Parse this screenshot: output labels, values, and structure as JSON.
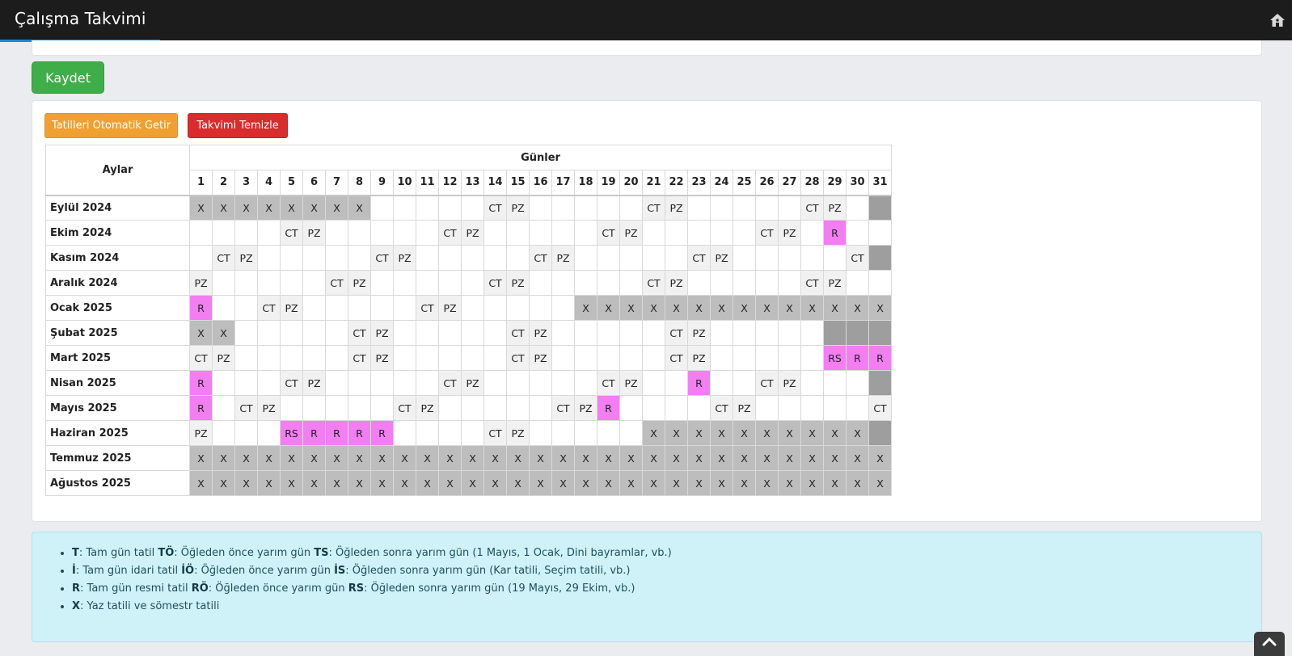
{
  "header": {
    "title": "Çalışma Takvimi",
    "home_icon": "home-icon"
  },
  "actions": {
    "save_label": "Kaydet",
    "auto_holidays_label": "Tatilleri Otomatik Getir",
    "clear_label": "Takvimi Temizle"
  },
  "table": {
    "months_header": "Aylar",
    "days_header": "Günler",
    "days": [
      "1",
      "2",
      "3",
      "4",
      "5",
      "6",
      "7",
      "8",
      "9",
      "10",
      "11",
      "12",
      "13",
      "14",
      "15",
      "16",
      "17",
      "18",
      "19",
      "20",
      "21",
      "22",
      "23",
      "24",
      "25",
      "26",
      "27",
      "28",
      "29",
      "30",
      "31"
    ],
    "rows": [
      {
        "month": "Eylül 2024",
        "cells": [
          "X",
          "X",
          "X",
          "X",
          "X",
          "X",
          "X",
          "X",
          "",
          "",
          "",
          "",
          "",
          "CT",
          "PZ",
          "",
          "",
          "",
          "",
          "",
          "CT",
          "PZ",
          "",
          "",
          "",
          "",
          "",
          "CT",
          "PZ",
          "",
          "D"
        ]
      },
      {
        "month": "Ekim 2024",
        "cells": [
          "",
          "",
          "",
          "",
          "CT",
          "PZ",
          "",
          "",
          "",
          "",
          "",
          "CT",
          "PZ",
          "",
          "",
          "",
          "",
          "",
          "CT",
          "PZ",
          "",
          "",
          "",
          "",
          "",
          "CT",
          "PZ",
          "",
          "R",
          "",
          ""
        ]
      },
      {
        "month": "Kasım 2024",
        "cells": [
          "",
          "CT",
          "PZ",
          "",
          "",
          "",
          "",
          "",
          "CT",
          "PZ",
          "",
          "",
          "",
          "",
          "",
          "CT",
          "PZ",
          "",
          "",
          "",
          "",
          "",
          "CT",
          "PZ",
          "",
          "",
          "",
          "",
          "",
          "CT",
          "D"
        ]
      },
      {
        "month": "Aralık 2024",
        "cells": [
          "PZ",
          "",
          "",
          "",
          "",
          "",
          "CT",
          "PZ",
          "",
          "",
          "",
          "",
          "",
          "CT",
          "PZ",
          "",
          "",
          "",
          "",
          "",
          "CT",
          "PZ",
          "",
          "",
          "",
          "",
          "",
          "CT",
          "PZ",
          "",
          ""
        ]
      },
      {
        "month": "Ocak 2025",
        "cells": [
          "R",
          "",
          "",
          "CT",
          "PZ",
          "",
          "",
          "",
          "",
          "",
          "CT",
          "PZ",
          "",
          "",
          "",
          "",
          "",
          "X",
          "X",
          "X",
          "X",
          "X",
          "X",
          "X",
          "X",
          "X",
          "X",
          "X",
          "X",
          "X",
          "X"
        ]
      },
      {
        "month": "Şubat 2025",
        "cells": [
          "X",
          "X",
          "",
          "",
          "",
          "",
          "",
          "CT",
          "PZ",
          "",
          "",
          "",
          "",
          "",
          "CT",
          "PZ",
          "",
          "",
          "",
          "",
          "",
          "CT",
          "PZ",
          "",
          "",
          "",
          "",
          "",
          "D",
          "D",
          "D"
        ]
      },
      {
        "month": "Mart 2025",
        "cells": [
          "CT",
          "PZ",
          "",
          "",
          "",
          "",
          "",
          "CT",
          "PZ",
          "",
          "",
          "",
          "",
          "",
          "CT",
          "PZ",
          "",
          "",
          "",
          "",
          "",
          "CT",
          "PZ",
          "",
          "",
          "",
          "",
          "",
          "RS",
          "R",
          "R"
        ]
      },
      {
        "month": "Nisan 2025",
        "cells": [
          "R",
          "",
          "",
          "",
          "CT",
          "PZ",
          "",
          "",
          "",
          "",
          "",
          "CT",
          "PZ",
          "",
          "",
          "",
          "",
          "",
          "CT",
          "PZ",
          "",
          "",
          "R",
          "",
          "",
          "CT",
          "PZ",
          "",
          "",
          "",
          "D"
        ]
      },
      {
        "month": "Mayıs 2025",
        "cells": [
          "R",
          "",
          "CT",
          "PZ",
          "",
          "",
          "",
          "",
          "",
          "CT",
          "PZ",
          "",
          "",
          "",
          "",
          "",
          "CT",
          "PZ",
          "R",
          "",
          "",
          "",
          "",
          "CT",
          "PZ",
          "",
          "",
          "",
          "",
          "",
          "CT"
        ]
      },
      {
        "month": "Haziran 2025",
        "cells": [
          "PZ",
          "",
          "",
          "",
          "RS",
          "R",
          "R",
          "R",
          "R",
          "",
          "",
          "",
          "",
          "CT",
          "PZ",
          "",
          "",
          "",
          "",
          "",
          "X",
          "X",
          "X",
          "X",
          "X",
          "X",
          "X",
          "X",
          "X",
          "X",
          "D"
        ]
      },
      {
        "month": "Temmuz 2025",
        "cells": [
          "X",
          "X",
          "X",
          "X",
          "X",
          "X",
          "X",
          "X",
          "X",
          "X",
          "X",
          "X",
          "X",
          "X",
          "X",
          "X",
          "X",
          "X",
          "X",
          "X",
          "X",
          "X",
          "X",
          "X",
          "X",
          "X",
          "X",
          "X",
          "X",
          "X",
          "X"
        ]
      },
      {
        "month": "Ağustos 2025",
        "cells": [
          "X",
          "X",
          "X",
          "X",
          "X",
          "X",
          "X",
          "X",
          "X",
          "X",
          "X",
          "X",
          "X",
          "X",
          "X",
          "X",
          "X",
          "X",
          "X",
          "X",
          "X",
          "X",
          "X",
          "X",
          "X",
          "X",
          "X",
          "X",
          "X",
          "X",
          "X"
        ]
      }
    ]
  },
  "legend": {
    "items": [
      {
        "parts": [
          {
            "b": "T",
            "t": ": Tam gün tatil "
          },
          {
            "b": "TÖ",
            "t": ": Öğleden önce yarım gün "
          },
          {
            "b": "TS",
            "t": ": Öğleden sonra yarım gün (1 Mayıs, 1 Ocak, Dini bayramlar, vb.)"
          }
        ]
      },
      {
        "parts": [
          {
            "b": "İ",
            "t": ": Tam gün idari tatil "
          },
          {
            "b": "İÖ",
            "t": ": Öğleden önce yarım gün "
          },
          {
            "b": "İS",
            "t": ": Öğleden sonra yarım gün (Kar tatili, Seçim tatili, vb.)"
          }
        ]
      },
      {
        "parts": [
          {
            "b": "R",
            "t": ": Tam gün resmi tatil "
          },
          {
            "b": "RÖ",
            "t": ": Öğleden önce yarım gün "
          },
          {
            "b": "RS",
            "t": ": Öğleden sonra yarım gün (19 Mayıs, 29 Ekim, vb.)"
          }
        ]
      },
      {
        "parts": [
          {
            "b": "X",
            "t": ": Yaz tatili ve sömestr tatili"
          }
        ]
      }
    ]
  },
  "colors": {
    "save_button": "#3fae49",
    "auto_button": "#f0a030",
    "clear_button": "#d92c2c",
    "holiday_x": "#bdbdbd",
    "weekend": "#f1f1f1",
    "official_holiday": "#f27ef2",
    "invalid_day": "#9e9e9e",
    "legend_bg": "#cff2f8"
  },
  "scroll_top_icon": "chevron-up-icon"
}
